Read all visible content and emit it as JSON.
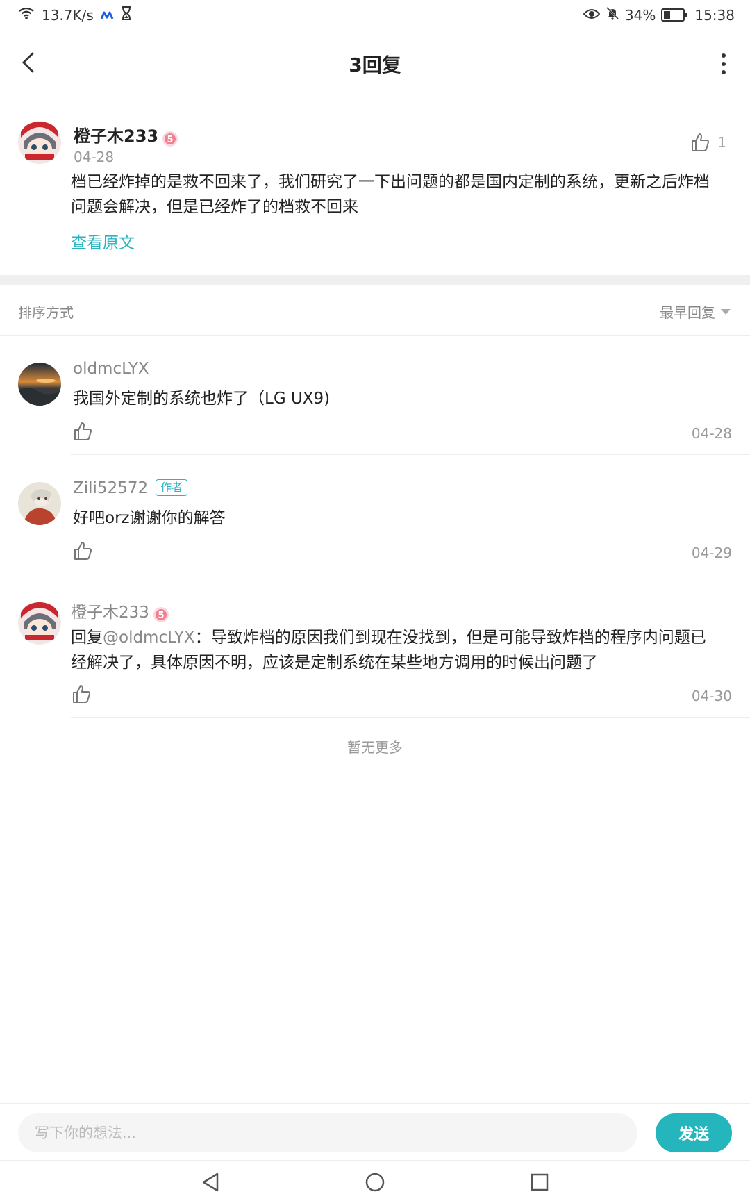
{
  "status_bar": {
    "speed": "13.7K/s",
    "battery": "34%",
    "battery_level": 0.34,
    "time": "15:38"
  },
  "header": {
    "title": "3回复"
  },
  "original_post": {
    "author": "橙子木233",
    "date": "04-28",
    "likes": "1",
    "lines": [
      "档已经炸掉的是救不回来了，我们研究了一下出问题的都是国内定制的系统，更新之后炸档",
      "问题会解决，但是已经炸了的档救不回来"
    ],
    "view_original": "查看原文"
  },
  "sort": {
    "label": "排序方式",
    "selected": "最早回复"
  },
  "replies": [
    {
      "author": "oldmcLYX",
      "text": "我国外定制的系统也炸了（LG UX9)",
      "date": "04-28"
    },
    {
      "author": "Zili52572",
      "tag": "作者",
      "text": "好吧orz谢谢你的解答",
      "date": "04-29"
    },
    {
      "author": "橙子木233",
      "reply_prefix": "回复",
      "mention": "@oldmcLYX",
      "line1": "：导致炸档的原因我们到现在没找到，但是可能导致炸档的程序内问题已",
      "line2": "经解决了，具体原因不明，应该是定制系统在某些地方调用的时候出问题了",
      "date": "04-30"
    }
  ],
  "no_more": "暂无更多",
  "composer": {
    "placeholder": "写下你的想法...",
    "send": "发送"
  },
  "colors": {
    "accent": "#25b6bd",
    "link": "#2bb3c0",
    "badge": "#f07f8f"
  }
}
